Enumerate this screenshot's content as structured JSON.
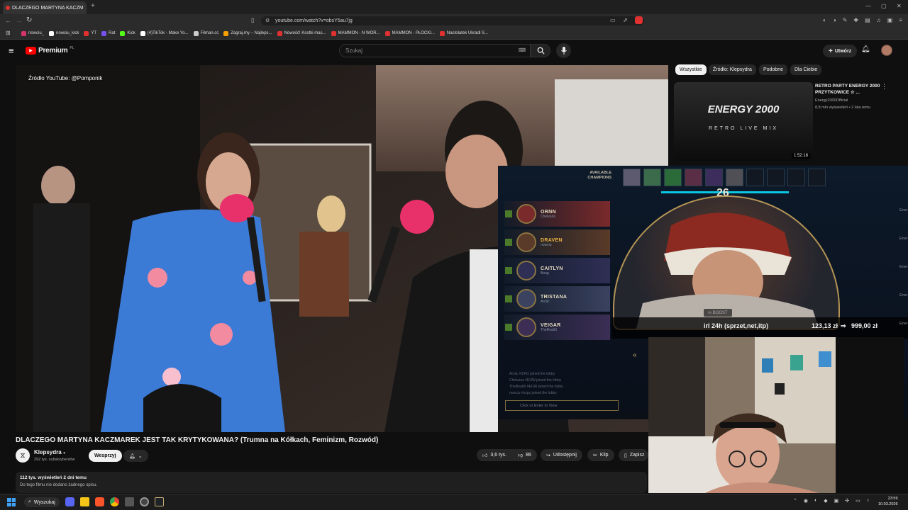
{
  "browser": {
    "tab_title": "DLACZEGO MARTYNA KACZM",
    "url": "youtube.com/watch?v=obsY5au7jg",
    "bookmarks": [
      {
        "label": "nowciu_",
        "color": "#d6336c"
      },
      {
        "label": "nowciu_kick",
        "color": "#ffffff"
      },
      {
        "label": "YT",
        "color": "#e0312e"
      },
      {
        "label": "Rat",
        "color": "#7950f2"
      },
      {
        "label": "Kick",
        "color": "#53fc18"
      },
      {
        "label": "(4)TikTok - Make Yo...",
        "color": "#ffffff"
      },
      {
        "label": "Filman.cc",
        "color": "#cccccc"
      },
      {
        "label": "Zagraj.my – Najleps...",
        "color": "#f59f00"
      },
      {
        "label": "Nowość! Kostki mas...",
        "color": "#e03131"
      },
      {
        "label": "MAMMON - N WOR...",
        "color": "#e03131"
      },
      {
        "label": "MAMMON - PŁOCKI...",
        "color": "#e03131"
      },
      {
        "label": "Nastolatek Ukradł S...",
        "color": "#e03131"
      }
    ]
  },
  "youtube": {
    "logo_text": "Premium",
    "logo_badge": "PL",
    "search_placeholder": "Szukaj",
    "create_label": "Utwórz",
    "chips": [
      "Wszystkie",
      "Źródło: Klepsydra",
      "Podobne",
      "Dla Ciebie"
    ],
    "video_watermark": "Źródło YouTube: @Pomponik",
    "video_title": "DLACZEGO MARTYNA KACZMAREK JEST TAK KRYTYKOWANA? (Trumna na Kółkach, Feminizm, Rozwód)",
    "channel_name": "Klepsydra",
    "subscribers": "292 tys. subskrybentów",
    "support_label": "Wesprzyj",
    "likes": "3,6 tys.",
    "dislikes": "86",
    "share_label": "Udostępnij",
    "clip_label": "Klip",
    "save_label": "Zapisz",
    "views_line": "112 tys. wyświetleń  2 dni temu",
    "description": "Do tego filmu nie dodano żadnego opisu.",
    "recommended": {
      "title": "RETRO PARTY ENERGY 2000 PRZYTKOWICE ☆ ...",
      "channel": "Energy2000Official",
      "meta": "8,8 mln wyświetleń • 2 lata temu",
      "duration": "1:52:18",
      "thumb_title": "ENERGY 2000",
      "thumb_sub": "RETRO LIVE MIX"
    }
  },
  "overlay": {
    "available_champions_label": "AVAILABLE CHAMPIONS",
    "timer": "26",
    "champions": [
      {
        "name": "ORNN",
        "player": "Chelvans",
        "color": "#7a2a2a"
      },
      {
        "name": "DRAVEN",
        "player": "nowciu",
        "color": "#5a3a28",
        "highlight": true
      },
      {
        "name": "CAITLYN",
        "player": "Boug",
        "color": "#2f2f55"
      },
      {
        "name": "TRISTANA",
        "player": "Arctic",
        "color": "#3a4260"
      },
      {
        "name": "VEIGAR",
        "player": "TheRealiX",
        "color": "#3c2e55"
      }
    ],
    "chat": [
      "Arctic #1041 joined the lobby",
      "Chelvans #EUW joined the lobby",
      "TheRealiX #EUW joined the lobby",
      "nowciu #xcpu joined the lobby"
    ],
    "chat_placeholder": "Click or Enter to View",
    "boost_label": "BOOST",
    "donation_goal": "irl 24h (sprzet,net,itp)",
    "donation_progress": "123,13 zł",
    "donation_target": "999,00 zł",
    "side_labels": [
      "Ener",
      "Ener",
      "Ener",
      "Ener",
      "Ener"
    ]
  },
  "taskbar": {
    "search_label": "Wyszukaj",
    "time": "23:59",
    "date": "10.03.2026"
  }
}
